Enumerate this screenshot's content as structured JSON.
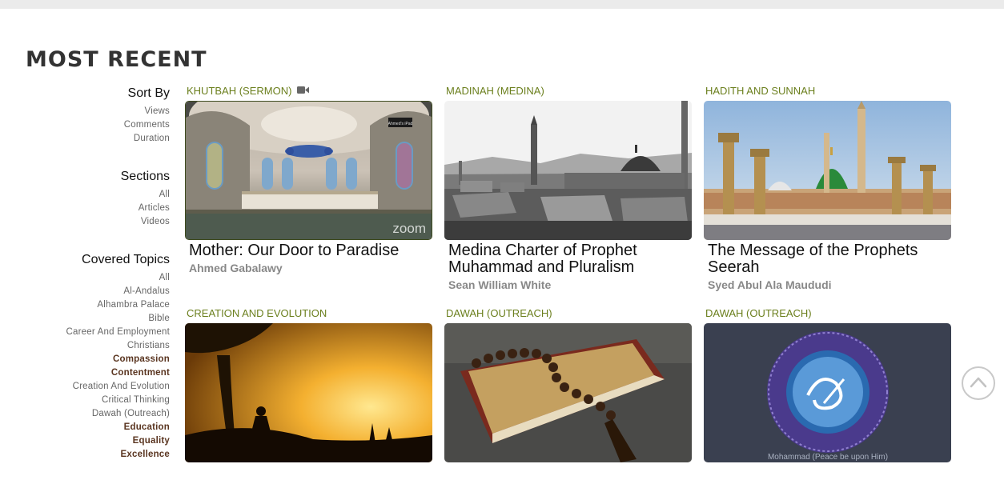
{
  "page": {
    "heading": "MOST RECENT"
  },
  "sidebar": {
    "sort_by": {
      "title": "Sort By",
      "items": [
        "Views",
        "Comments",
        "Duration"
      ]
    },
    "sections": {
      "title": "Sections",
      "items": [
        "All",
        "Articles",
        "Videos"
      ]
    },
    "topics": {
      "title": "Covered Topics",
      "items": [
        {
          "label": "All",
          "bold": false
        },
        {
          "label": "Al-Andalus",
          "bold": false
        },
        {
          "label": "Alhambra Palace",
          "bold": false
        },
        {
          "label": "Bible",
          "bold": false
        },
        {
          "label": "Career And Employment",
          "bold": false
        },
        {
          "label": "Christians",
          "bold": false
        },
        {
          "label": "Compassion",
          "bold": true
        },
        {
          "label": "Contentment",
          "bold": true
        },
        {
          "label": "Creation And Evolution",
          "bold": false
        },
        {
          "label": "Critical Thinking",
          "bold": false
        },
        {
          "label": "Dawah (Outreach)",
          "bold": false
        },
        {
          "label": "Education",
          "bold": true
        },
        {
          "label": "Equality",
          "bold": true
        },
        {
          "label": "Excellence",
          "bold": true
        }
      ]
    }
  },
  "cards": [
    {
      "category": "KHUTBAH (SERMON)",
      "has_video_icon": true,
      "title": "Mother: Our Door to Paradise",
      "author": "Ahmed Gabalawy",
      "thumb_overlay": "zoom",
      "thumb_label": "Ahmed's iPad"
    },
    {
      "category": "MADINAH (MEDINA)",
      "has_video_icon": false,
      "title": "Medina Charter of Prophet Muhammad and Pluralism",
      "author": "Sean William White"
    },
    {
      "category": "HADITH AND SUNNAH",
      "has_video_icon": false,
      "title": "The Message of the Prophets Seerah",
      "author": "Syed Abul Ala Maududi"
    },
    {
      "category": "CREATION AND EVOLUTION",
      "has_video_icon": false,
      "title": "",
      "author": ""
    },
    {
      "category": "DAWAH (OUTREACH)",
      "has_video_icon": false,
      "title": "",
      "author": ""
    },
    {
      "category": "DAWAH (OUTREACH)",
      "has_video_icon": false,
      "title": "",
      "author": "",
      "thumb_caption": "Mohammad (Peace be upon Him)"
    }
  ],
  "colors": {
    "category": "#6b7f1d",
    "accent_topic": "#5a3520",
    "topbar": "#ebebeb"
  },
  "icons": {
    "video": "video-camera-icon",
    "scroll_top": "chevron-up-icon"
  }
}
